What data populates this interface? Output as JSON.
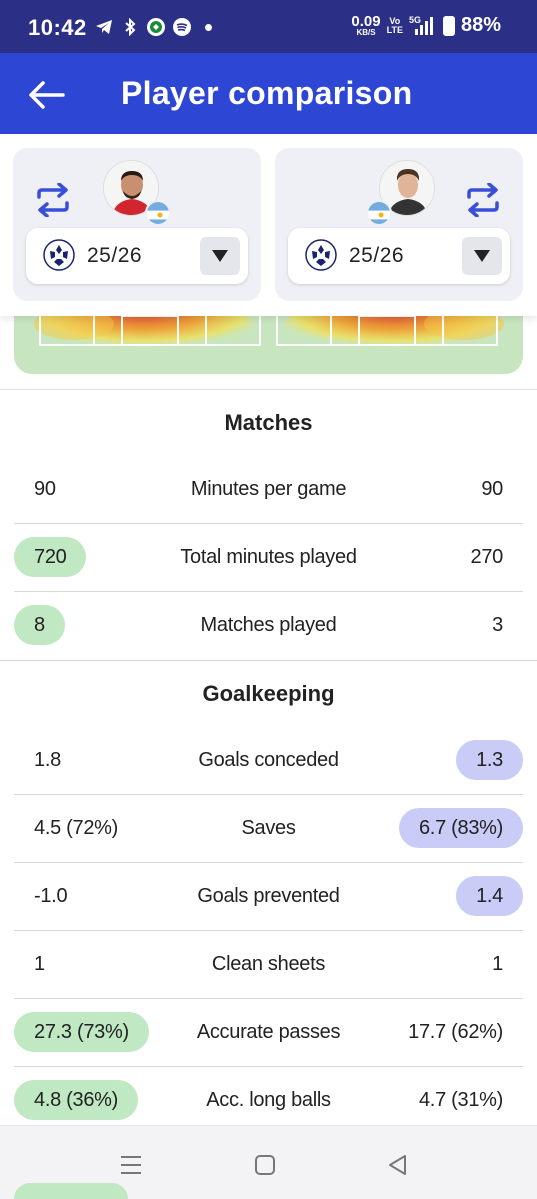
{
  "status_bar": {
    "time": "10:42",
    "speed_value": "0.09",
    "speed_unit": "KB/S",
    "volte_top": "Vo",
    "volte_bottom": "LTE",
    "network": "5G",
    "battery": "88%",
    "icons": [
      "telegram-icon",
      "bluetooth-icon",
      "app-icon",
      "spotify-icon",
      "dot-icon",
      "signal-icon",
      "battery-icon"
    ]
  },
  "app_bar": {
    "title": "Player comparison",
    "back_icon": "arrow-left-icon"
  },
  "players": [
    {
      "season": "25/26",
      "flag": "argentina-flag",
      "competition_icon": "champions-league-icon"
    },
    {
      "season": "25/26",
      "flag": "argentina-flag",
      "competition_icon": "champions-league-icon"
    }
  ],
  "colors": {
    "app_bar": "#2e46d4",
    "status_bar": "#2b2f86",
    "left_highlight": "#bfe8c3",
    "right_highlight": "#c8ccf7",
    "accent_icon": "#3a4fd8"
  },
  "sections": [
    {
      "title": "Matches",
      "rows": [
        {
          "label": "Minutes per game",
          "left": "90",
          "right": "90",
          "winner": "none"
        },
        {
          "label": "Total minutes played",
          "left": "720",
          "right": "270",
          "winner": "left"
        },
        {
          "label": "Matches played",
          "left": "8",
          "right": "3",
          "winner": "left"
        }
      ]
    },
    {
      "title": "Goalkeeping",
      "rows": [
        {
          "label": "Goals conceded",
          "left": "1.8",
          "right": "1.3",
          "winner": "right"
        },
        {
          "label": "Saves",
          "left": "4.5 (72%)",
          "right": "6.7 (83%)",
          "winner": "right"
        },
        {
          "label": "Goals prevented",
          "left": "-1.0",
          "right": "1.4",
          "winner": "right"
        },
        {
          "label": "Clean sheets",
          "left": "1",
          "right": "1",
          "winner": "none"
        },
        {
          "label": "Accurate passes",
          "left": "27.3 (73%)",
          "right": "17.7 (62%)",
          "winner": "left"
        },
        {
          "label": "Acc. long balls",
          "left": "4.8 (36%)",
          "right": "4.7 (31%)",
          "winner": "left"
        }
      ]
    }
  ],
  "nav": [
    "recent-apps-icon",
    "home-icon",
    "back-icon"
  ]
}
